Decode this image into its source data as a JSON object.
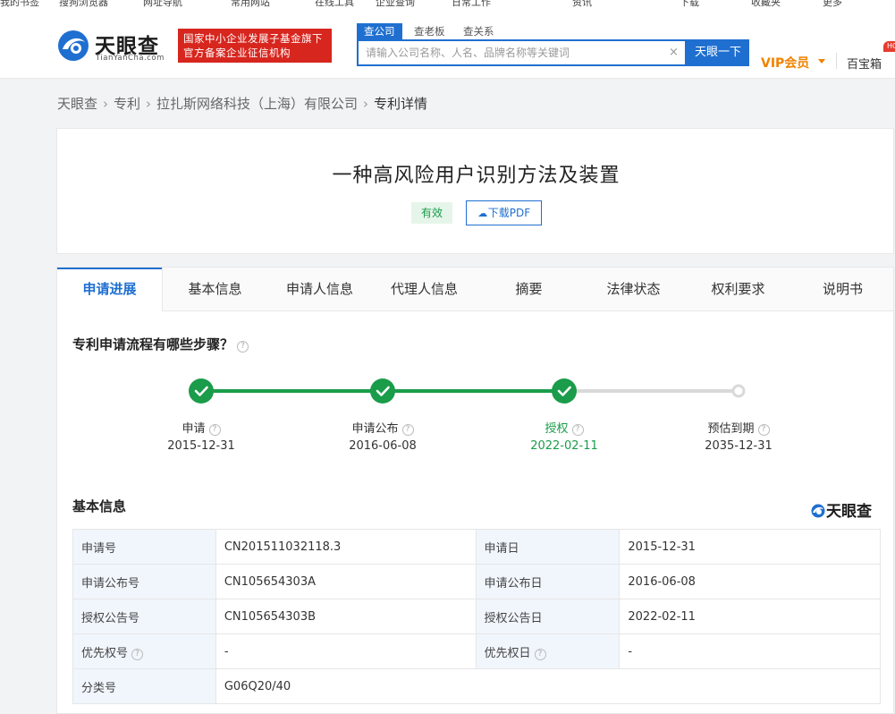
{
  "bookmarks": [
    "我的书签",
    "搜狗浏览器",
    "网址导航",
    "常用网站",
    "在线工具",
    "企业查询",
    "日常工作",
    "资讯",
    "下载",
    "收藏夹",
    "更多"
  ],
  "header": {
    "logo_text": "天眼查",
    "logo_sub": "TianYanCha.com",
    "badge_line1": "国家中小企业发展子基金旗下",
    "badge_line2": "官方备案企业征信机构",
    "search_tabs": [
      "查公司",
      "查老板",
      "查关系"
    ],
    "search_placeholder": "请输入公司名称、人名、品牌名称等关键词",
    "search_button": "天眼一下",
    "vip": "VIP会员",
    "treasure": "百宝箱",
    "hot": "HOT"
  },
  "breadcrumb": [
    "天眼查",
    "专利",
    "拉扎斯网络科技（上海）有限公司",
    "专利详情"
  ],
  "patent": {
    "title": "一种高风险用户识别方法及装置",
    "status": "有效",
    "download": "下载PDF"
  },
  "tabs": [
    "申请进展",
    "基本信息",
    "申请人信息",
    "代理人信息",
    "摘要",
    "法律状态",
    "权利要求",
    "说明书"
  ],
  "progress": {
    "title": "专利申请流程有哪些步骤？",
    "steps": [
      {
        "label": "申请",
        "date": "2015-12-31",
        "done": true
      },
      {
        "label": "申请公布",
        "date": "2016-06-08",
        "done": true
      },
      {
        "label": "授权",
        "date": "2022-02-11",
        "done": true
      },
      {
        "label": "预估到期",
        "date": "2035-12-31",
        "done": false
      }
    ],
    "colors": {
      "done": "#1a9c4a",
      "pending": "#d9d9d9"
    }
  },
  "basic": {
    "title": "基本信息",
    "watermark": "天眼查",
    "rows": [
      {
        "k1": "申请号",
        "v1": "CN201511032118.3",
        "k2": "申请日",
        "v2": "2015-12-31"
      },
      {
        "k1": "申请公布号",
        "v1": "CN105654303A",
        "k2": "申请公布日",
        "v2": "2016-06-08"
      },
      {
        "k1": "授权公告号",
        "v1": "CN105654303B",
        "k2": "授权公告日",
        "v2": "2022-02-11"
      },
      {
        "k1": "优先权号",
        "v1": "-",
        "k2": "优先权日",
        "v2": "-"
      },
      {
        "k1": "分类号",
        "v1": "G06Q20/40"
      }
    ]
  }
}
